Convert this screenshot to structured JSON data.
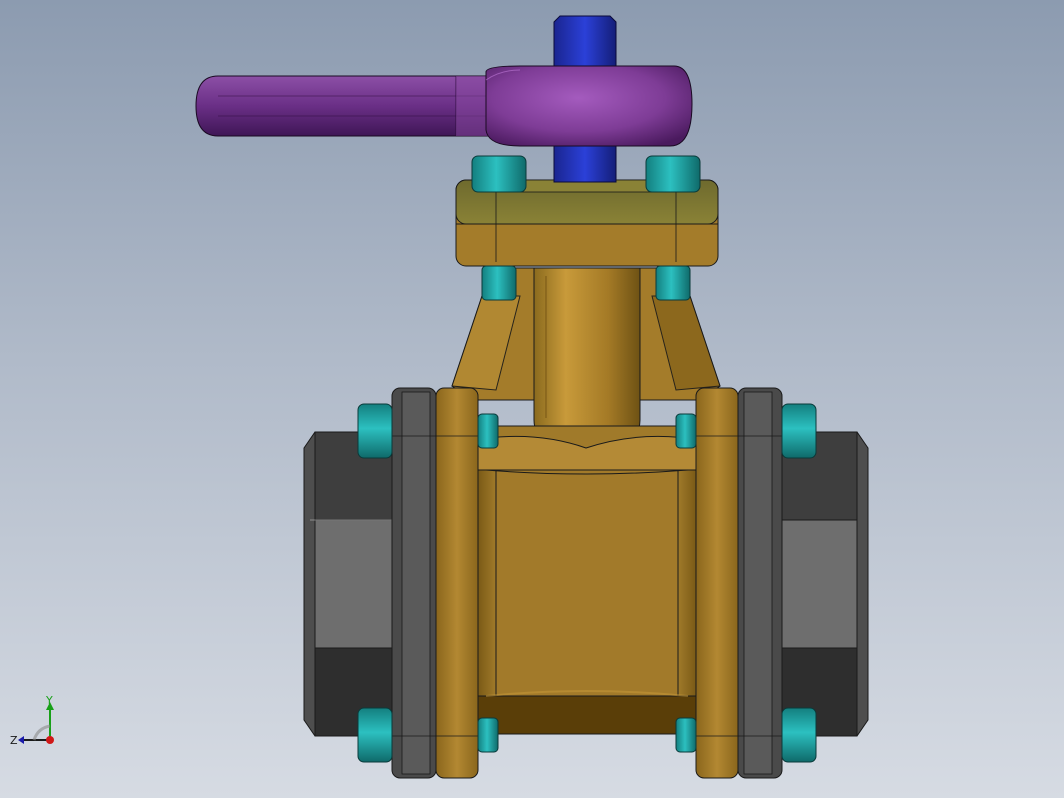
{
  "window": {
    "title": ""
  },
  "triad": {
    "x_axis_color": "#d01818",
    "y_axis_color": "#18a018",
    "z_axis_color": "#1a1aaa",
    "labels": {
      "y": "Y",
      "z": "Z"
    }
  },
  "colors": {
    "body": "#a87f2c",
    "body_shadow": "#5a3e08",
    "bonnet": "#7a7434",
    "bolt": "#1ea6a6",
    "end_cap": "#4a4a4a",
    "handle": "#7a3a92",
    "stem": "#2a3cc8",
    "edge": "#1a1a1a"
  },
  "model": {
    "parts": [
      "handle",
      "stem",
      "bonnet",
      "bonnet-bolts",
      "body",
      "flange-left",
      "flange-right",
      "end-cap-left",
      "end-cap-right",
      "body-bolts"
    ]
  }
}
